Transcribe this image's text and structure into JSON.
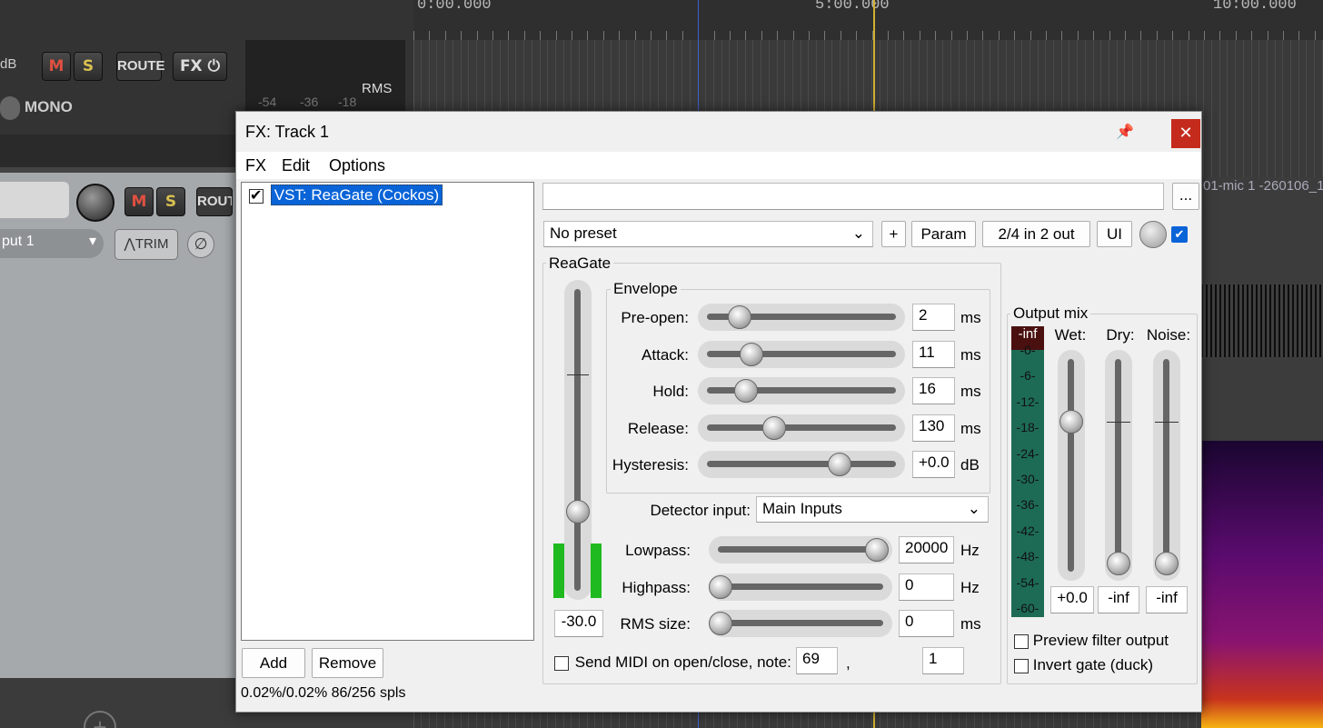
{
  "daw": {
    "ruler": [
      "0:00.000",
      "5:00.000",
      "10:00.000"
    ],
    "track1": {
      "db_label": "dB",
      "mute": "M",
      "solo": "S",
      "route": "ROUTE",
      "fx": "FX",
      "mono": "MONO",
      "rms": "RMS",
      "meter_ticks": [
        "-54",
        "-36",
        "-18"
      ]
    },
    "track2": {
      "mute": "M",
      "solo": "S",
      "route": "ROUT",
      "input": "put 1",
      "trim": "TRIM"
    },
    "item_label": "01-mic 1 -260106_1"
  },
  "dialog": {
    "title": "FX: Track 1",
    "menu": [
      "FX",
      "Edit",
      "Options"
    ],
    "fx_chain": [
      {
        "name": "VST: ReaGate (Cockos)",
        "enabled": true
      }
    ],
    "add_label": "Add",
    "remove_label": "Remove",
    "cpu_status": "0.02%/0.02% 86/256 spls",
    "more_label": "...",
    "preset": "No preset",
    "plus_label": "+",
    "param_label": "Param",
    "io_label": "2/4 in 2 out",
    "ui_label": "UI",
    "plugin_name": "ReaGate",
    "threshold_value": "-30.0",
    "envelope": {
      "title": "Envelope",
      "rows": [
        {
          "label": "Pre-open:",
          "value": "2",
          "unit": "ms",
          "pos": 0.12
        },
        {
          "label": "Attack:",
          "value": "11",
          "unit": "ms",
          "pos": 0.19
        },
        {
          "label": "Hold:",
          "value": "16",
          "unit": "ms",
          "pos": 0.16
        },
        {
          "label": "Release:",
          "value": "130",
          "unit": "ms",
          "pos": 0.32
        },
        {
          "label": "Hysteresis:",
          "value": "+0.0",
          "unit": "dB",
          "pos": 0.7
        }
      ]
    },
    "detector_label": "Detector input:",
    "detector_value": "Main Inputs",
    "filters": [
      {
        "label": "Lowpass:",
        "value": "20000",
        "unit": "Hz",
        "pos": 0.98
      },
      {
        "label": "Highpass:",
        "value": "0",
        "unit": "Hz",
        "pos": 0.0
      },
      {
        "label": "RMS size:",
        "value": "0",
        "unit": "ms",
        "pos": 0.0
      }
    ],
    "send_midi_label": "Send MIDI on open/close, note:",
    "midi_note": "69",
    "comma": ",",
    "midi_channel": "1",
    "output_mix": {
      "title": "Output mix",
      "peak": "-inf",
      "scale": [
        "-0-",
        "-6-",
        "-12-",
        "-18-",
        "-24-",
        "-30-",
        "-36-",
        "-42-",
        "-48-",
        "-54-",
        "-60-"
      ],
      "wet_label": "Wet:",
      "dry_label": "Dry:",
      "noise_label": "Noise:",
      "wet_value": "+0.0",
      "dry_value": "-inf",
      "noise_value": "-inf"
    },
    "preview_label": "Preview filter output",
    "invert_label": "Invert gate (duck)"
  }
}
